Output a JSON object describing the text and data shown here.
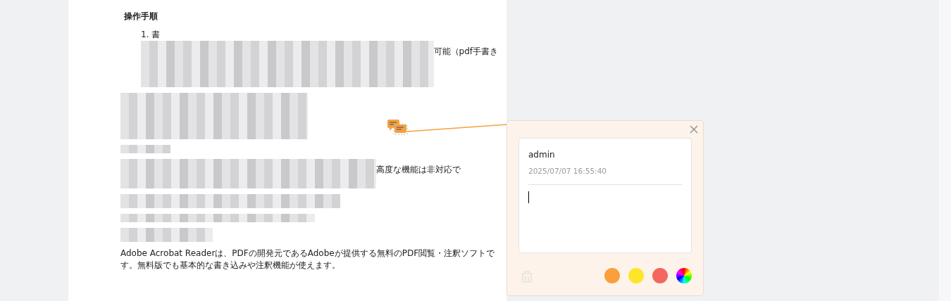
{
  "document": {
    "blocks": [
      {
        "kind": "heading",
        "text": "操作手順"
      },
      {
        "kind": "list_item",
        "text": "1. 書"
      },
      {
        "kind": "redacted",
        "fragment": "可能（pdf手書き"
      },
      {
        "kind": "redacted"
      },
      {
        "kind": "redacted"
      },
      {
        "kind": "redacted",
        "fragment": "高度な機能は非対応で"
      },
      {
        "kind": "redacted"
      },
      {
        "kind": "redacted"
      },
      {
        "kind": "redacted"
      },
      {
        "kind": "paragraph",
        "text": "Adobe Acrobat Readerは、PDFの開発元であるAdobeが提供する無料のPDF閲覧・注釈ソフトです。無料版でも基本的な書き込みや注釈機能が使えます。"
      }
    ]
  },
  "comment_popup": {
    "author": "admin",
    "timestamp": "2025/07/07 16:55:40",
    "colors": [
      {
        "color": "#f9a03c",
        "selected": false
      },
      {
        "color": "#fde52a",
        "selected": false
      },
      {
        "color": "#f4675f",
        "selected": false
      },
      {
        "kind": "picker",
        "selected": false
      }
    ]
  }
}
